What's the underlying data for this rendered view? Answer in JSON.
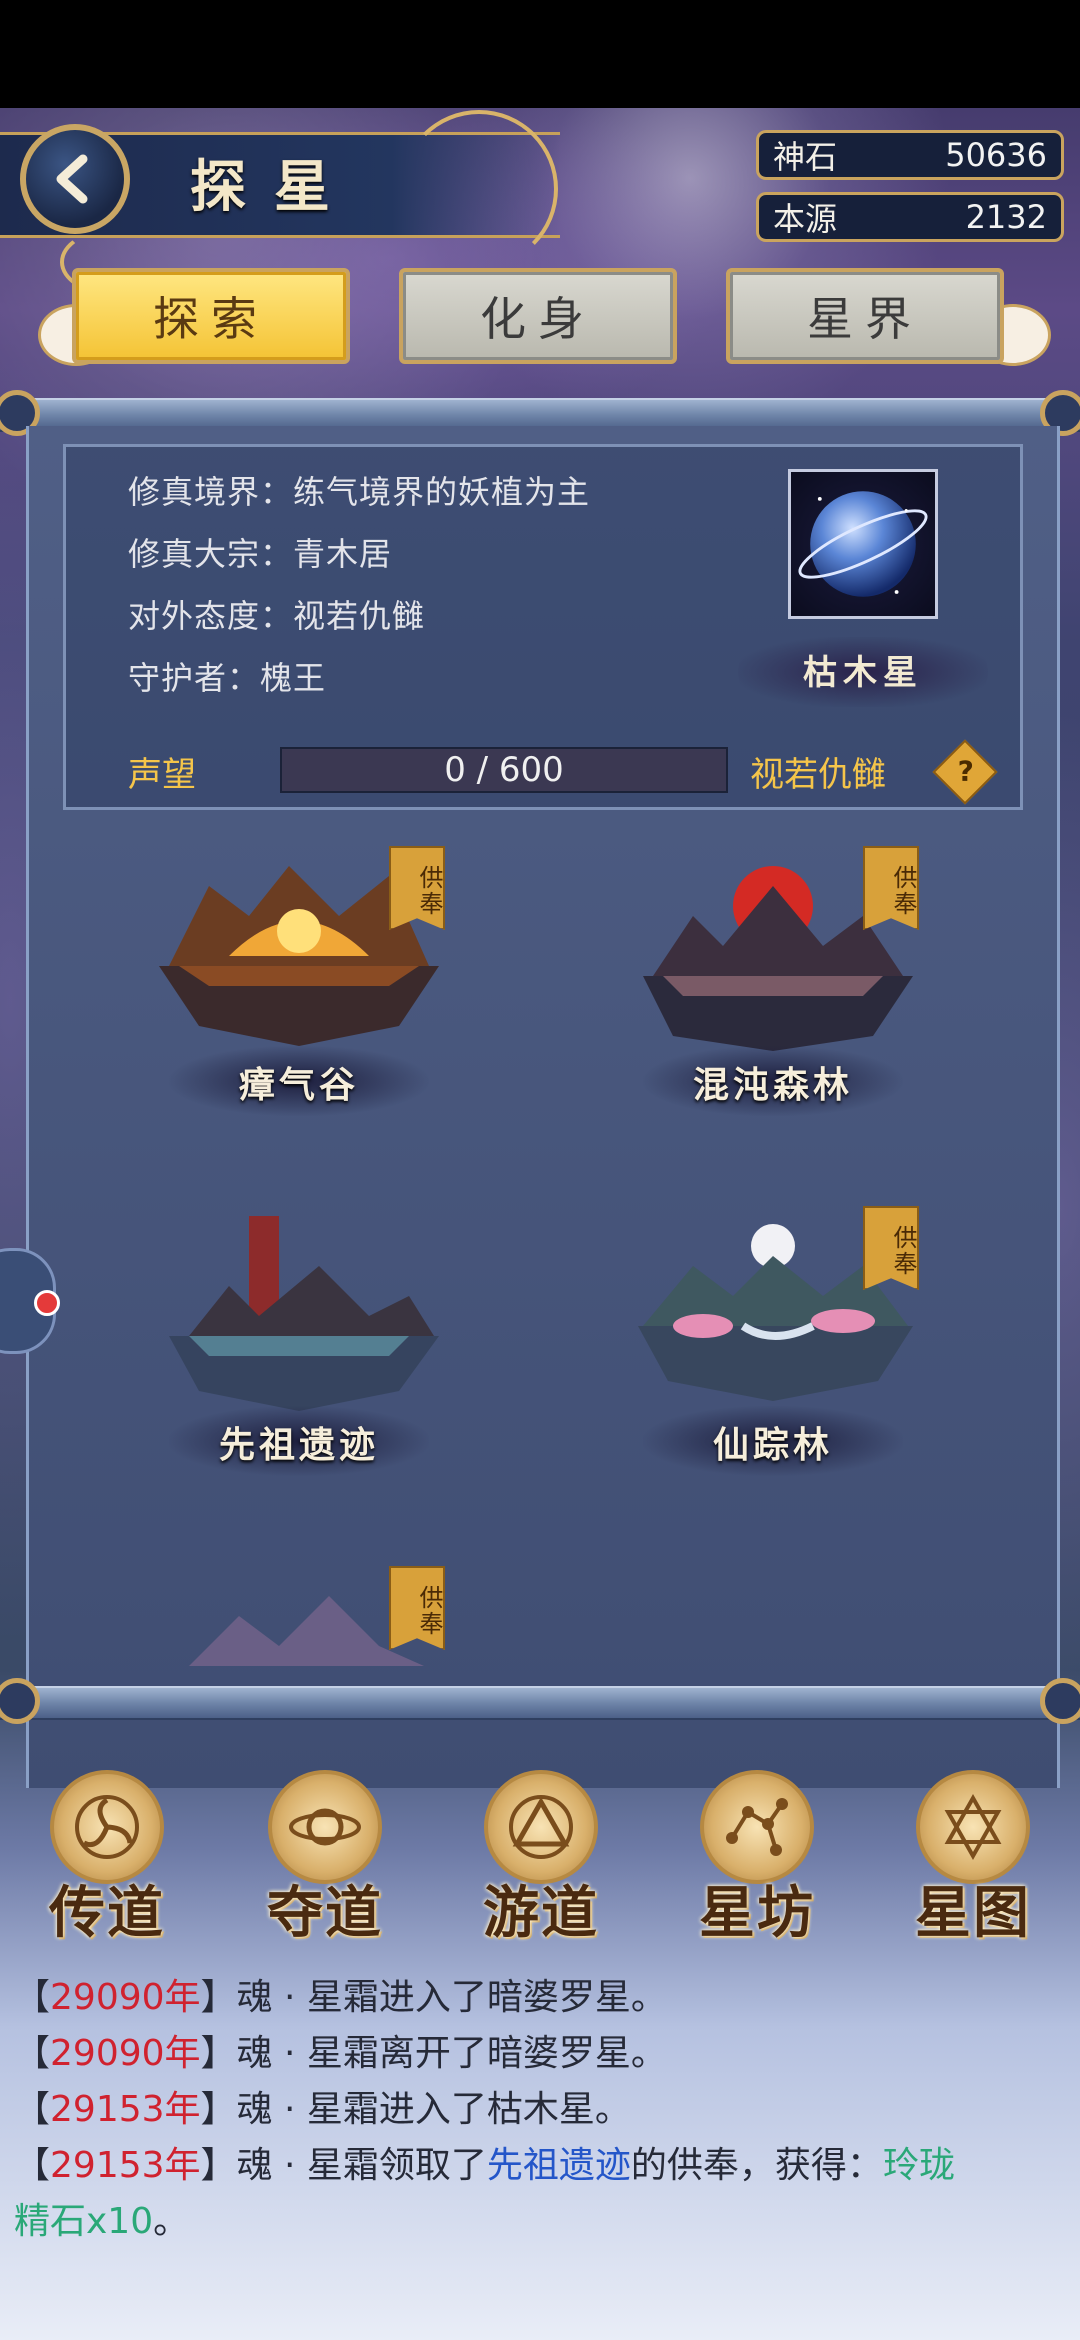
{
  "header": {
    "title": "探星",
    "currencies": [
      {
        "label": "神石",
        "value": "50636"
      },
      {
        "label": "本源",
        "value": "2132"
      }
    ]
  },
  "tabs": [
    {
      "label": "探索",
      "active": true
    },
    {
      "label": "化身",
      "active": false
    },
    {
      "label": "星界",
      "active": false
    }
  ],
  "star_info": {
    "realm": "修真境界：练气境界的妖植为主",
    "sect": "修真大宗：青木居",
    "attitude_line": "对外态度：视若仇雠",
    "guardian": "守护者：槐王",
    "planet_name": "枯木星",
    "reputation_label": "声望",
    "reputation_text": "0 / 600",
    "reputation_value": 0,
    "reputation_max": 600,
    "attitude": "视若仇雠",
    "help_icon": "?"
  },
  "locations": [
    {
      "name": "瘴气谷",
      "tribute": "供奉"
    },
    {
      "name": "混沌森林",
      "tribute": "供奉"
    },
    {
      "name": "先祖遗迹",
      "tribute": ""
    },
    {
      "name": "仙踪林",
      "tribute": "供奉"
    },
    {
      "name": "",
      "tribute": "供奉"
    }
  ],
  "bottom_nav": [
    {
      "label": "传道",
      "icon": "triskelion-icon"
    },
    {
      "label": "夺道",
      "icon": "crescent-orbit-icon"
    },
    {
      "label": "游道",
      "icon": "triangle-circle-icon"
    },
    {
      "label": "星坊",
      "icon": "constellation-icon"
    },
    {
      "label": "星图",
      "icon": "hexagram-icon"
    }
  ],
  "log": [
    {
      "year": "29090年",
      "text": "魂 · 星霜进入了暗婆罗星。"
    },
    {
      "year": "29090年",
      "text": "魂 · 星霜离开了暗婆罗星。"
    },
    {
      "year": "29153年",
      "text": "魂 · 星霜进入了枯木星。"
    },
    {
      "year": "29153年",
      "pre": "魂 · 星霜领取了",
      "place": "先祖遗迹",
      "mid": "的供奉，获得：",
      "reward_a": "玲珑",
      "reward_b": "精石x10",
      "end": "。"
    }
  ],
  "colors": {
    "accent_gold": "#c9a35f",
    "active_tab": "#f4c334",
    "reputation_text": "#f5c54a",
    "log_year": "#d0222f",
    "log_link": "#2456c9",
    "log_item": "#2aa878"
  }
}
